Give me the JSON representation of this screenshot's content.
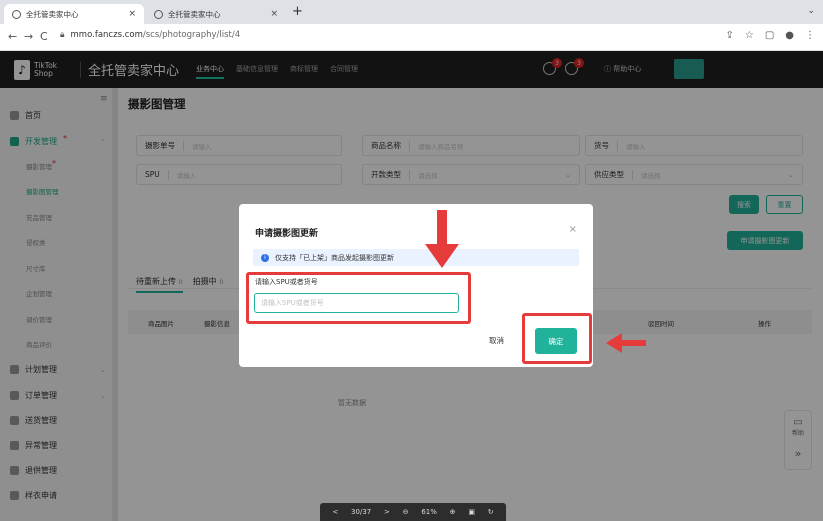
{
  "browser": {
    "tabs": [
      {
        "label": "全托管卖家中心"
      },
      {
        "label": "全托管卖家中心"
      }
    ],
    "new_tab": "+",
    "url_host": "mmo.fanczs.com",
    "url_path": "/scs/photography/list/4"
  },
  "app": {
    "logo_text_1": "TikTok",
    "logo_text_2": "Shop",
    "title": "全托管卖家中心",
    "nav": [
      "业务中心",
      "基础信息管理",
      "商标管理",
      "合同管理"
    ],
    "badge_count_1": "3",
    "badge_count_2": "3",
    "help_label": "帮助中心"
  },
  "sidebar": {
    "items": [
      {
        "label": "首页"
      },
      {
        "label": "开发管理"
      },
      {
        "label": "计划管理"
      },
      {
        "label": "订单管理"
      },
      {
        "label": "送货管理"
      },
      {
        "label": "异常管理"
      },
      {
        "label": "退供管理"
      },
      {
        "label": "样衣申请"
      }
    ],
    "sub_items": [
      "摄影管理",
      "摄影图管理",
      "充品管理",
      "侵权类",
      "尺寸库",
      "企划管理",
      "调价管理",
      "商品评价"
    ]
  },
  "main": {
    "title": "摄影图管理",
    "filters": {
      "photo_no_label": "摄影单号",
      "photo_no_ph": "请输入",
      "product_name_label": "商品名称",
      "product_name_ph": "请输入商品名称",
      "sku_label": "货号",
      "sku_ph": "请输入",
      "spu_label": "SPU",
      "spu_ph": "请输入",
      "dev_type_label": "开款类型",
      "dev_type_ph": "请选择",
      "supplier_type_label": "供应类型",
      "supplier_type_ph": "请选择"
    },
    "search_btn": "搜索",
    "reset_btn": "重置",
    "apply_btn": "申请摄影图更新",
    "tabs": [
      {
        "label": "待重新上传",
        "count": "0"
      },
      {
        "label": "拍摄中",
        "count": "0"
      }
    ],
    "columns": [
      "商品图片",
      "摄影信息",
      "驳回时间",
      "操作"
    ],
    "empty_text": "暂无数据"
  },
  "pager": {
    "prev": "<",
    "page": "30/37",
    "next": ">",
    "zoom": "61%"
  },
  "float": {
    "help": "帮助",
    "expand": "»"
  },
  "modal": {
    "title": "申请摄影图更新",
    "close": "×",
    "notice": "仅支持「已上架」商品发起摄影图更新",
    "field_label": "请输入SPU或者货号",
    "field_placeholder": "请输入SPU或者货号",
    "field_value": "",
    "cancel": "取消",
    "confirm": "确定"
  },
  "colors": {
    "accent": "#20b29a",
    "highlight": "#e63b3b",
    "header_bg": "#1f1f1f"
  }
}
